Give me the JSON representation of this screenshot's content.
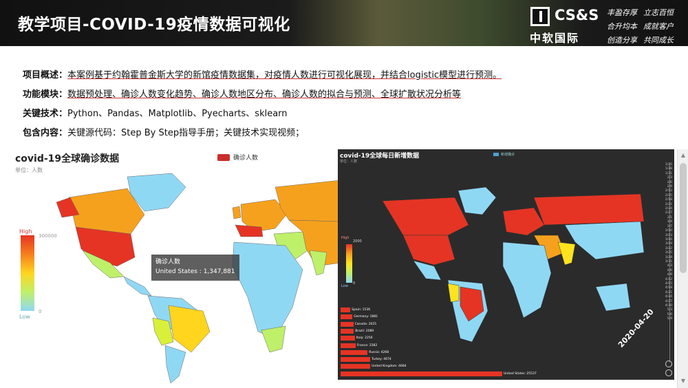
{
  "header": {
    "title": "教学项目-COVID-19疫情数据可视化",
    "logo_text": "CS&S",
    "logo_cn": "中软国际",
    "slogans": [
      "丰盈存厚",
      "立志百恒",
      "合升均本",
      "成就客户",
      "创造分享",
      "共同成长"
    ]
  },
  "info": {
    "rows": [
      {
        "label": "项目概述：",
        "text": "本案例基于约翰霍普金斯大学的新馆疫情数据集，对疫情人数进行可视化展现，并结合logistic模型进行预测。"
      },
      {
        "label": "功能模块：",
        "text": "数据预处理、确诊人数变化趋势、确诊人数地区分布、确诊人数的拟合与预测、全球扩散状况分析等"
      },
      {
        "label": "关键技术：",
        "text": "Python、Pandas、Matplotlib、Pyecharts、sklearn"
      },
      {
        "label": "包含内容：",
        "text": "关键源代码：Step By Step指导手册；关键技术实现视频；"
      }
    ]
  },
  "chart1": {
    "title": "covid-19全球确诊数据",
    "subtitle": "单位：人数",
    "legend": "确诊人数",
    "visual_high": "High",
    "visual_low": "Low",
    "visual_max": "300000",
    "visual_min": "0",
    "tooltip_series": "确诊人数",
    "tooltip_value": "United States : 1,347,881"
  },
  "chart2": {
    "title": "covid-19全球每日新增数据",
    "subtitle": "单位：人数",
    "legend": "新增确诊",
    "visual_high": "High",
    "visual_low": "Low",
    "visual_max": "2000",
    "visual_min": "0",
    "date": "2020-04-20",
    "timeline": [
      "1/25",
      "1/28",
      "1/31",
      "2/3",
      "2/6",
      "2/9",
      "2/12",
      "2/15",
      "2/18",
      "2/21",
      "2/24",
      "2/27",
      "3/1",
      "3/4",
      "3/7",
      "3/10",
      "3/13",
      "3/16",
      "3/19",
      "3/22",
      "3/25",
      "3/28",
      "3/31",
      "4/3",
      "4/6",
      "4/9",
      "4/12",
      "4/15",
      "4/18",
      "4/21",
      "4/24",
      "4/27",
      "4/30",
      "5/3",
      "5/6",
      "5/9"
    ]
  },
  "colors": {
    "accent": "#e53424",
    "map_low": "#8fd8f4",
    "map_high": "#e53424",
    "dark_bg": "#2b2b2b"
  },
  "chart_data": {
    "type": "bar",
    "title": "covid-19全球每日新增数据",
    "categories": [
      "Spain",
      "Germany",
      "Canada",
      "Brazil",
      "Italy",
      "France",
      "Russia",
      "Turkey",
      "United Kingdom",
      "United States"
    ],
    "values": [
      1536,
      1881,
      2025,
      2089,
      2256,
      2382,
      4268,
      4674,
      4684,
      25537
    ],
    "labels": [
      "Spain: 1536",
      "Germany: 1881",
      "Canada: 2025",
      "Brazil: 2089",
      "Italy: 2256",
      "France: 2382",
      "Russia: 4268",
      "Turkey: 4674",
      "United Kingdom: 4684",
      "United States: 25537"
    ]
  }
}
